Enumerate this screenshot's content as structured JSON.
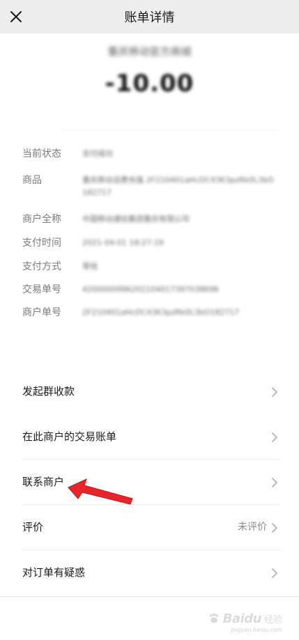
{
  "header": {
    "title": "账单详情",
    "close_icon": "close-icon"
  },
  "summary": {
    "merchant": "重庆移动官方商城",
    "amount": "-10.00"
  },
  "details": [
    {
      "label": "当前状态",
      "value": "支付成功"
    },
    {
      "label": "商品",
      "value": "重庆移动话费充值 2F210401aHcDC43K3pzRk0L3bO182717"
    },
    {
      "label": "商户全称",
      "value": "中国移动通信集团重庆有限公司"
    },
    {
      "label": "支付时间",
      "value": "2021-04-01 18:27:19"
    },
    {
      "label": "支付方式",
      "value": "零钱"
    },
    {
      "label": "交易单号",
      "value": "4200000996202104017397038696"
    },
    {
      "label": "商户单号",
      "value": "2F210401aHcDC43K3pzRk0L3bO182717"
    }
  ],
  "menu": [
    {
      "label": "发起群收款",
      "right": ""
    },
    {
      "label": "在此商户的交易账单",
      "right": ""
    },
    {
      "label": "联系商户",
      "right": ""
    },
    {
      "label": "评价",
      "right": "未评价"
    },
    {
      "label": "对订单有疑惑",
      "right": ""
    }
  ],
  "annotation": {
    "color": "#e8252a"
  },
  "watermark": {
    "brand": "Baidu",
    "sub": "经验",
    "url": "jingyan.baidu.com"
  }
}
